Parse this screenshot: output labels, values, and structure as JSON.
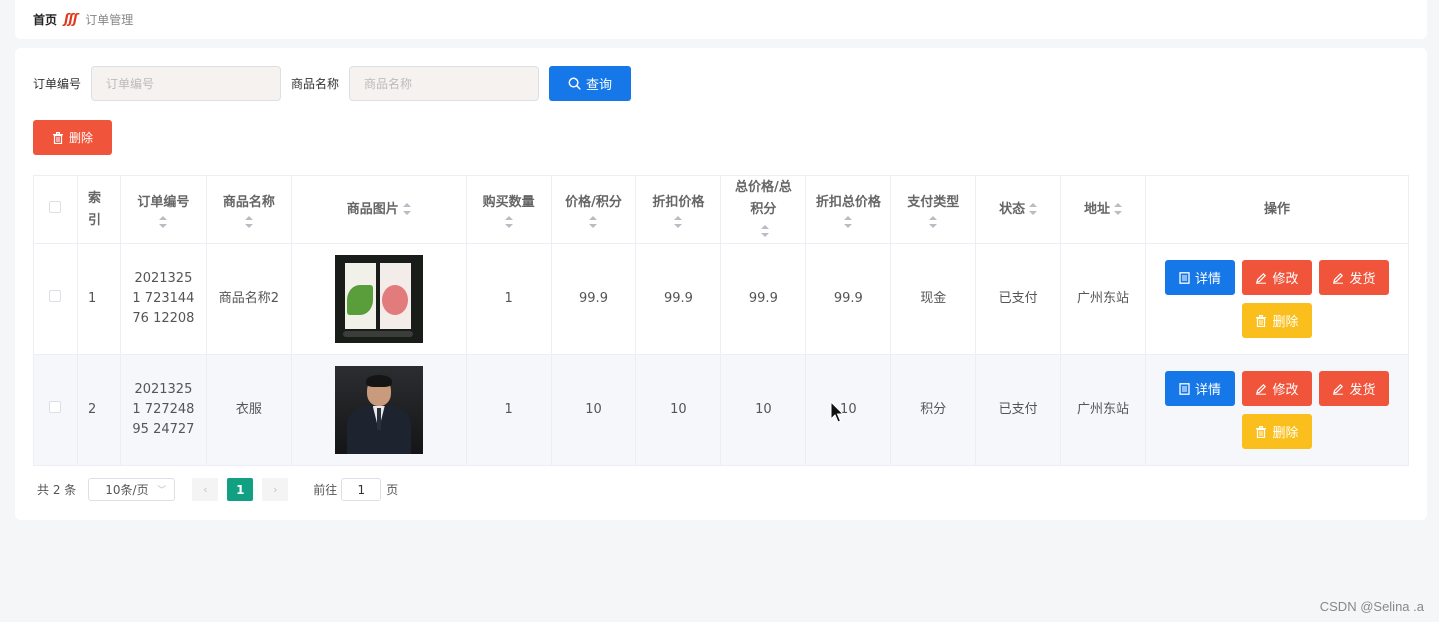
{
  "breadcrumb": {
    "home": "首页",
    "separator": "ʃʃʃ",
    "current": "订单管理"
  },
  "search": {
    "order_no_label": "订单编号",
    "order_no_placeholder": "订单编号",
    "order_no_value": "",
    "product_name_label": "商品名称",
    "product_name_placeholder": "商品名称",
    "product_name_value": "",
    "query_label": "查询"
  },
  "toolbar": {
    "delete_label": "删除"
  },
  "table": {
    "headers": {
      "index": "索引",
      "order_no": "订单编号",
      "product_name": "商品名称",
      "product_image": "商品图片",
      "quantity": "购买数量",
      "price": "价格/积分",
      "discount_price": "折扣价格",
      "total": "总价格/总积分",
      "discount_total": "折扣总价格",
      "pay_type": "支付类型",
      "status": "状态",
      "address": "地址",
      "actions": "操作"
    },
    "rows": [
      {
        "index": "1",
        "order_no": "20213251723144761208",
        "order_no_display": "20213251 72314476 12208",
        "product_name": "商品名称2",
        "quantity": "1",
        "price": "99.9",
        "discount_price": "99.9",
        "total": "99.9",
        "discount_total": "99.9",
        "pay_type": "现金",
        "status": "已支付",
        "address": "广州东站"
      },
      {
        "index": "2",
        "order_no": "20213251727248952472 7",
        "order_no_display": "20213251 72724895 24727",
        "product_name": "衣服",
        "quantity": "1",
        "price": "10",
        "discount_price": "10",
        "total": "10",
        "discount_total": "10",
        "pay_type": "积分",
        "status": "已支付",
        "address": "广州东站"
      }
    ],
    "row_actions": {
      "detail": "详情",
      "edit": "修改",
      "ship": "发货",
      "delete": "删除"
    }
  },
  "pagination": {
    "total_text": "共 2 条",
    "page_size": "10条/页",
    "current_page": "1",
    "goto_label": "前往",
    "goto_value": "1",
    "page_suffix": "页"
  },
  "watermark": "CSDN @Selina .a",
  "colors": {
    "primary": "#1677e8",
    "danger": "#f0553c",
    "warning": "#fbbf1d",
    "pager_active": "#12a082"
  }
}
